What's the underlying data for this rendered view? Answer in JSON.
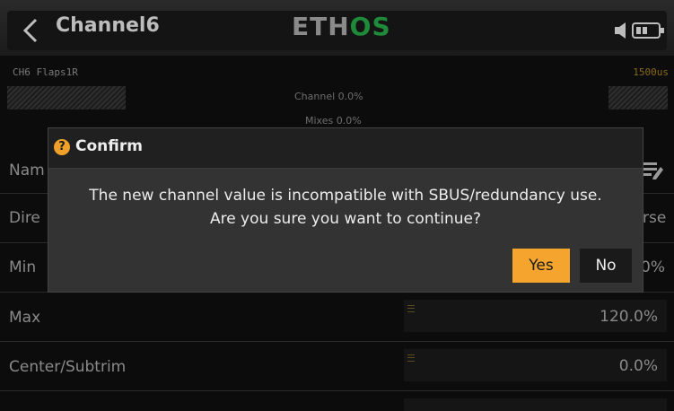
{
  "header": {
    "title": "Channel6",
    "logo_main": "ETH",
    "logo_accent": "OS"
  },
  "channel_strip": {
    "channel_name": "CH6  Flaps1R",
    "output_us": "1500us",
    "channel_stat": "Channel   0.0%",
    "mixes_stat": "Mixes    0.0%"
  },
  "rows": {
    "name_label_partial": "Nam",
    "direction_label_partial": "Dire",
    "direction_value_partial": "rse",
    "min_label": "Min",
    "min_value_partial": "0%",
    "max_label": "Max",
    "max_value": "120.0%",
    "center_label": "Center/Subtrim",
    "center_value": "0.0%"
  },
  "dialog": {
    "title": "Confirm",
    "icon_glyph": "?",
    "message_line1": "The new channel value is incompatible with SBUS/redundancy use.",
    "message_line2": "Are you sure you want to continue?",
    "yes_label": "Yes",
    "no_label": "No"
  },
  "colors": {
    "accent": "#f5a52e",
    "logo_green": "#1f8a3a",
    "background": "#0c0c0c",
    "dialog_bg": "#333333"
  },
  "icons": [
    "back-chevron-icon",
    "speaker-icon",
    "battery-icon",
    "edit-icon",
    "question-icon",
    "drag-handle-icon"
  ]
}
